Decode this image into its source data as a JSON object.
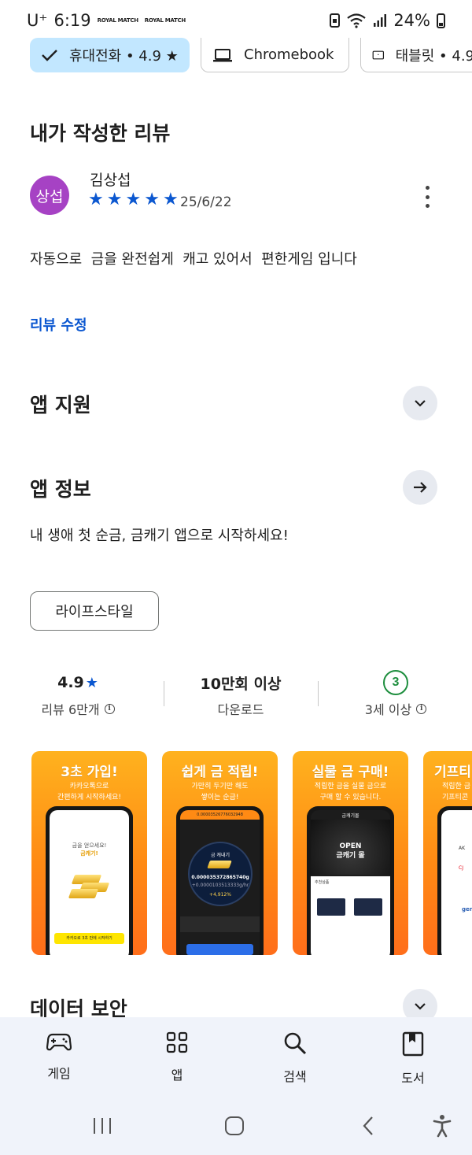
{
  "status_bar": {
    "carrier": "U⁺",
    "time": "6:19",
    "notif_badges": [
      "ROYAL MATCH",
      "ROYAL MATCH"
    ],
    "battery": "24%"
  },
  "device_chips": [
    {
      "label": "휴대전화 • 4.9 ★",
      "icon": "check-icon",
      "selected": true
    },
    {
      "label": "Chromebook",
      "icon": "laptop-icon",
      "selected": false
    },
    {
      "label": "태블릿 • 4.9",
      "icon": "tablet-icon",
      "selected": false
    }
  ],
  "my_review": {
    "heading": "내가 작성한 리뷰",
    "avatar_text": "상섭",
    "avatar_color": "#a642c4",
    "reviewer": "김상섭",
    "rating": 5,
    "date": "25/6/22",
    "text": "자동으로  금을 완전쉽게  캐고 있어서  편한게임 입니다",
    "edit_link": "리뷰 수정"
  },
  "app_support": {
    "heading": "앱 지원"
  },
  "app_info": {
    "heading": "앱 정보",
    "description": "내 생애 첫 순금, 금캐기 앱으로 시작하세요!",
    "category": "라이프스타일"
  },
  "stats": {
    "rating_value": "4.9",
    "rating_label": "리뷰 6만개",
    "downloads_value": "10만회 이상",
    "downloads_label": "다운로드",
    "age_value": "3",
    "age_label": "3세 이상"
  },
  "screenshots": [
    {
      "title": "3초 가입!",
      "subtitle": "카카오톡으로\n간편하게 시작하세요!",
      "screen_line1": "금을 얻으세요!",
      "screen_line2": "금캐기!",
      "screen_footer": "카카오로 3초 만에 시작하기"
    },
    {
      "title": "쉽게 금 적립!",
      "subtitle": "가만히 두기만 해도\n쌓이는 순금!",
      "screen_top": "0.00003526776032948",
      "screen_label": "금 캐내기",
      "screen_value": "0.000035372865740g",
      "screen_rate": "+0.0000103513333g/hr",
      "screen_pct": "+4,912%"
    },
    {
      "title": "실물 금 구매!",
      "subtitle": "적립한 금을 실물 금으로\n구매 할 수 있습니다.",
      "screen_brand": "금캐기몰",
      "screen_banner": "OPEN\n금캐기 몰",
      "screen_section": "추천상품"
    },
    {
      "title": "기프티",
      "subtitle": "적립한 금\n기프티콘",
      "screen_brands": [
        "AK",
        "CJ",
        "genie"
      ]
    }
  ],
  "data_safety": {
    "heading": "데이터 보안"
  },
  "bottom_nav": [
    {
      "label": "게임",
      "icon": "gamepad-icon"
    },
    {
      "label": "앱",
      "icon": "apps-grid-icon"
    },
    {
      "label": "검색",
      "icon": "search-icon"
    },
    {
      "label": "도서",
      "icon": "book-icon"
    }
  ],
  "colors": {
    "accent_blue": "#0b57d0",
    "chip_selected_bg": "#c2e7ff",
    "age_green": "#1e8e3e",
    "nav_bg": "#f0f3fa"
  }
}
